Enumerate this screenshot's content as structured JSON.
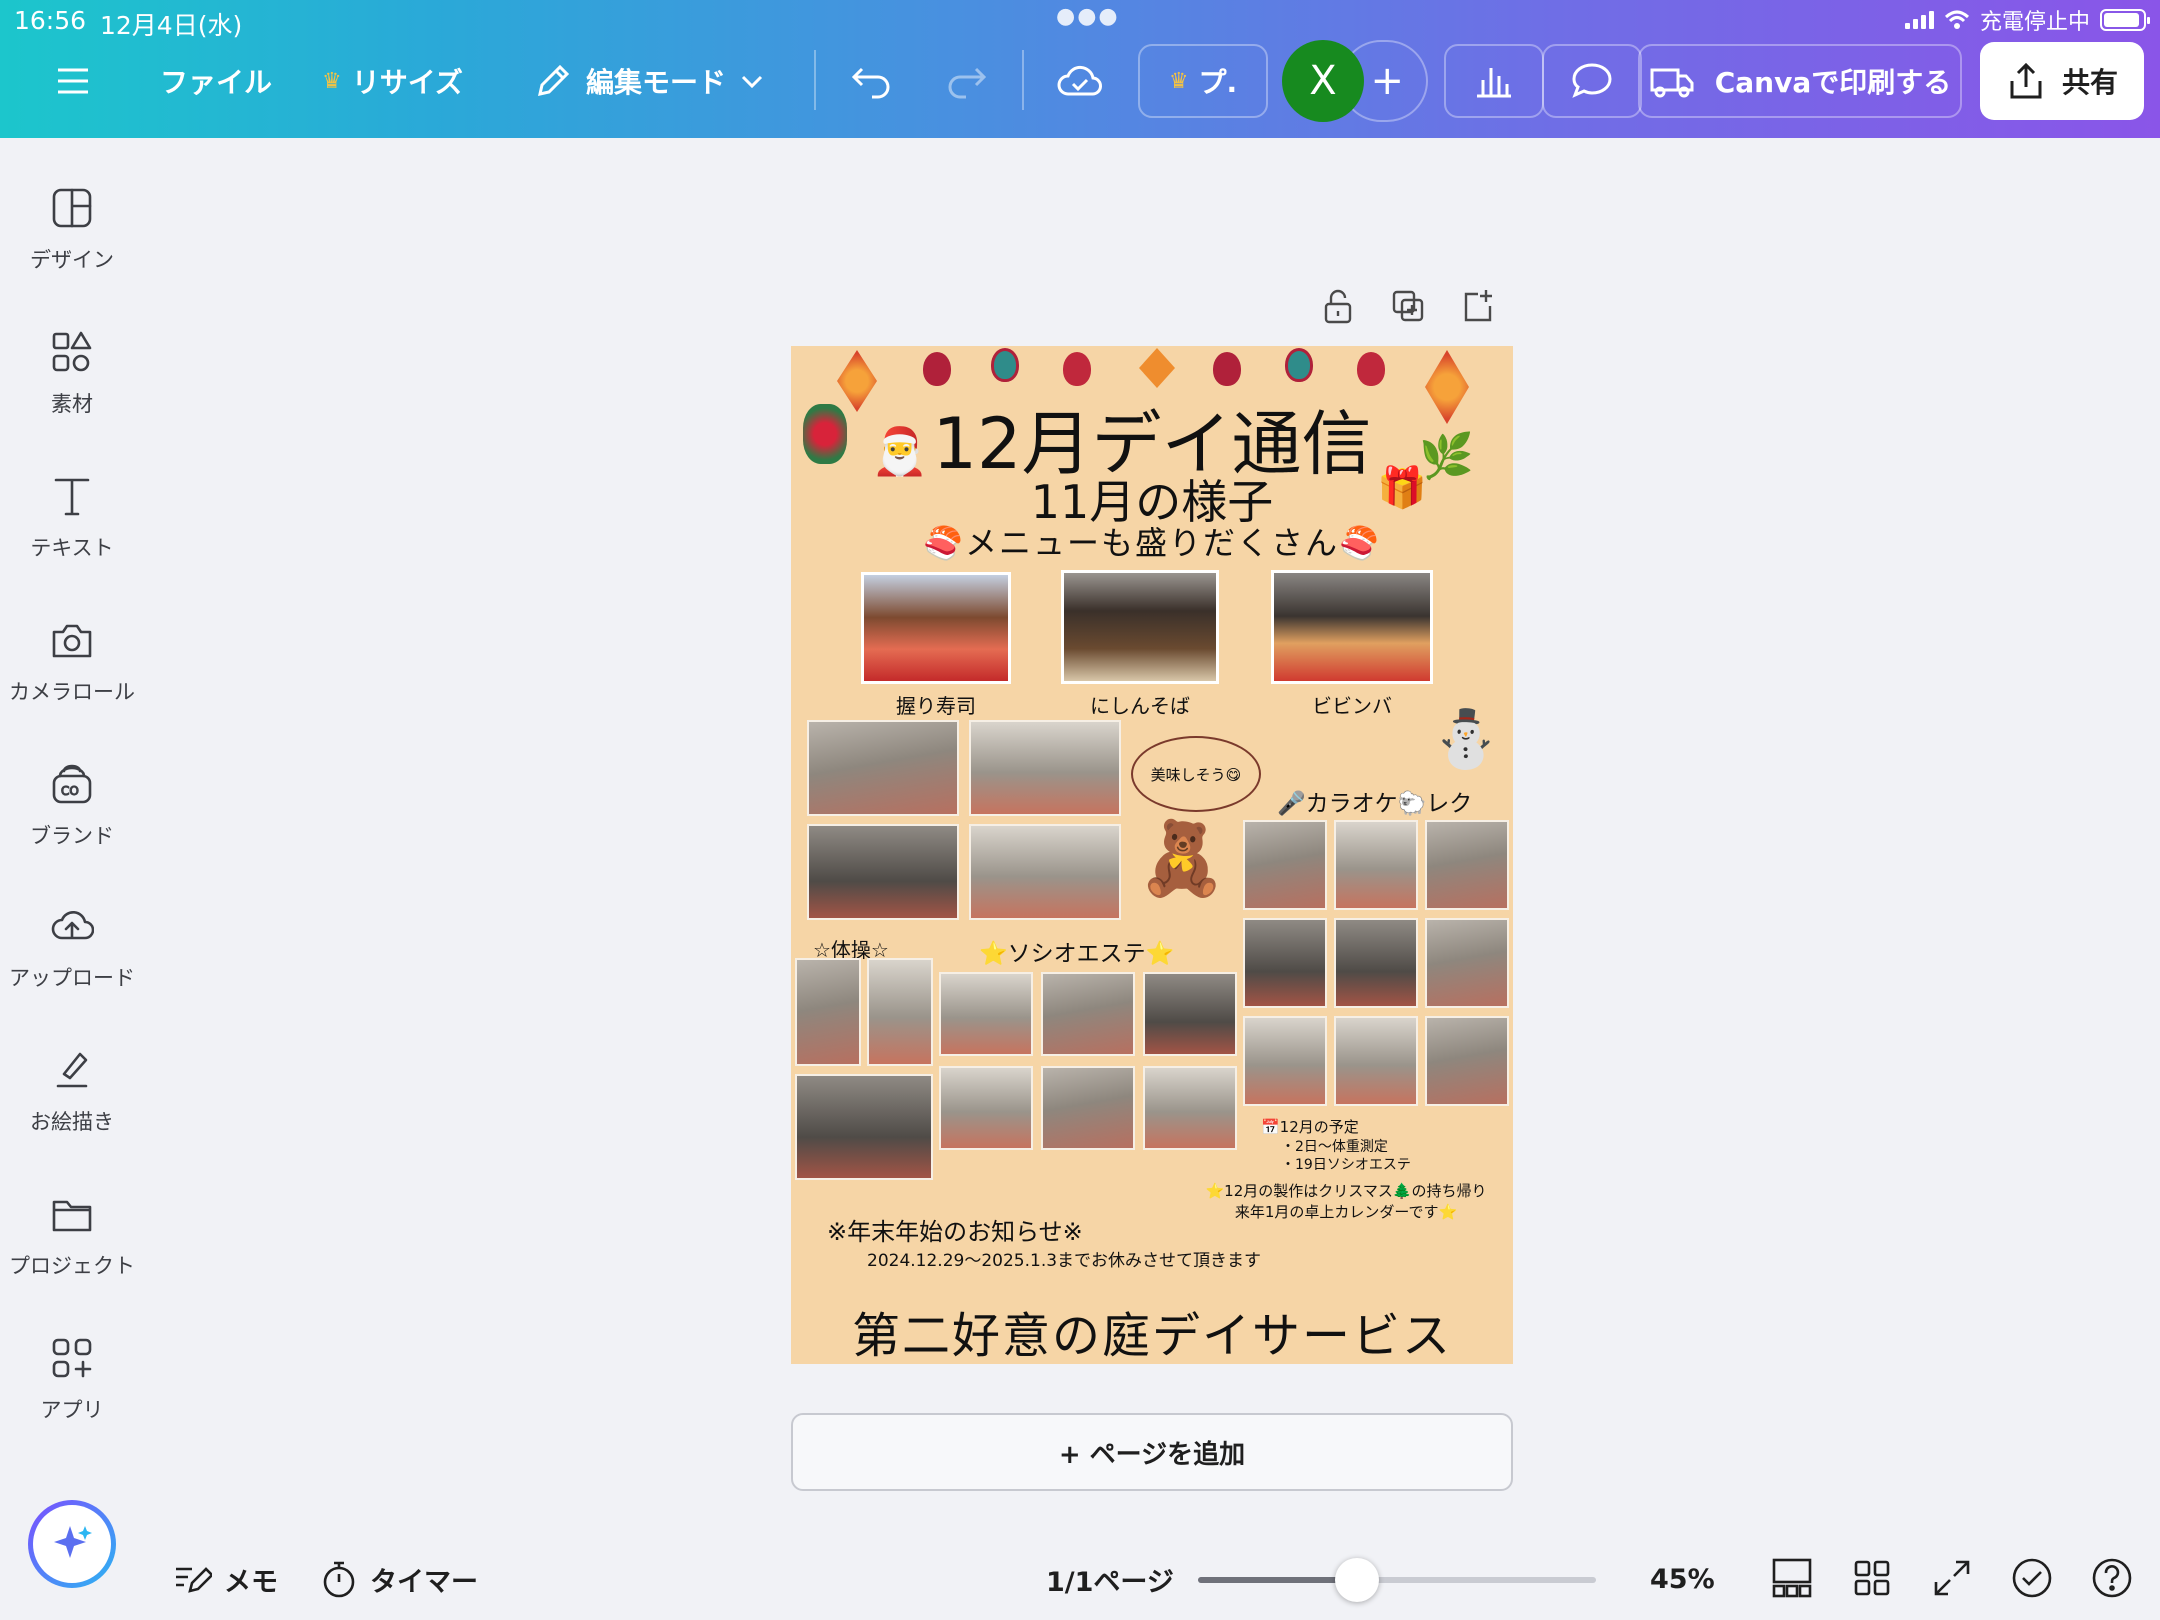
{
  "status": {
    "time": "16:56",
    "date": "12月4日(水)",
    "charging": "充電停止中"
  },
  "toolbar": {
    "file": "ファイル",
    "resize": "リサイズ",
    "edit_mode": "編集モード",
    "pro_label": "プ.",
    "avatar": "X",
    "print": "Canvaで印刷する",
    "share": "共有"
  },
  "sidebar": {
    "items": [
      {
        "label": "デザイン",
        "icon": "design-icon"
      },
      {
        "label": "素材",
        "icon": "elements-icon"
      },
      {
        "label": "テキスト",
        "icon": "text-icon"
      },
      {
        "label": "カメラロール",
        "icon": "camera-icon"
      },
      {
        "label": "ブランド",
        "icon": "brand-icon"
      },
      {
        "label": "アップロード",
        "icon": "upload-icon"
      },
      {
        "label": "お絵描き",
        "icon": "draw-icon"
      },
      {
        "label": "プロジェクト",
        "icon": "folder-icon"
      },
      {
        "label": "アプリ",
        "icon": "apps-icon"
      }
    ]
  },
  "design": {
    "title": "12月デイ通信",
    "subtitle": "11月の様子",
    "menu_heading": "🍣メニューも盛りだくさん🍣",
    "food": [
      {
        "label": "握り寿司"
      },
      {
        "label": "にしんそば"
      },
      {
        "label": "ビビンバ"
      }
    ],
    "speech": "美味しそう😋",
    "karaoke": "🎤カラオケ🐑レク",
    "exercise": "☆体操☆",
    "beauty": "⭐ソシオエステ⭐",
    "schedule": {
      "heading": "📅12月の予定",
      "line1": "・2日〜体重測定",
      "line2": "・19日ソシオエステ"
    },
    "craft": {
      "line1": "⭐12月の製作はクリスマス🌲の持ち帰り",
      "line2": "来年1月の卓上カレンダーです⭐"
    },
    "notice": {
      "heading": "※年末年始のお知らせ※",
      "body": "2024.12.29〜2025.1.3までお休みさせて頂きます"
    },
    "footer": "第二好意の庭デイサービス"
  },
  "canvas": {
    "add_page": "+ ページを追加"
  },
  "bottom": {
    "memo": "メモ",
    "timer": "タイマー",
    "page_indicator": "1/1ページ",
    "zoom": "45%",
    "zoom_level": 0.4
  },
  "colors": {
    "page_bg": "#f6d5a6",
    "brand_gradient_start": "#1cc6cc",
    "brand_gradient_end": "#8a55e8",
    "avatar_bg": "#178a1f"
  }
}
